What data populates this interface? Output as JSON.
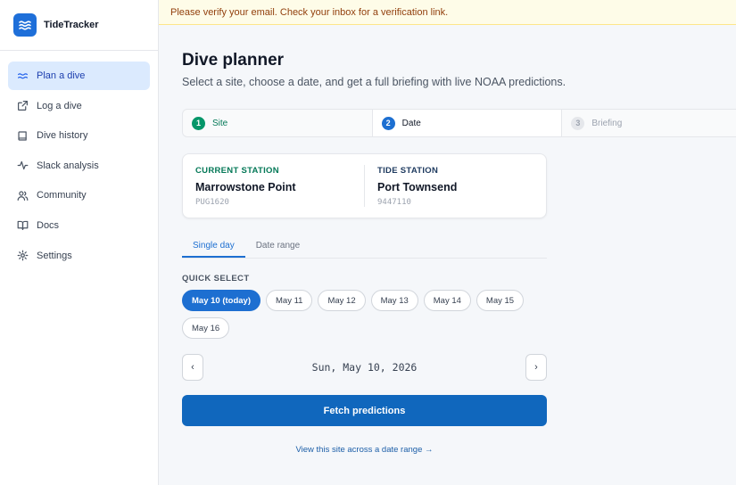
{
  "app": {
    "name": "TideTracker",
    "logo_icon": "waves-icon",
    "accent": "#1e6fd9"
  },
  "banner": {
    "text": "Please verify your email. Check your inbox for a verification link."
  },
  "sidebar": {
    "items": [
      {
        "label": "Plan a dive",
        "icon": "waves-icon",
        "active": true
      },
      {
        "label": "Log a dive",
        "icon": "external-link-icon"
      },
      {
        "label": "Dive history",
        "icon": "book-icon"
      },
      {
        "label": "Slack analysis",
        "icon": "activity-icon"
      },
      {
        "label": "Community",
        "icon": "users-icon"
      },
      {
        "label": "Docs",
        "icon": "book-open-icon"
      },
      {
        "label": "Settings",
        "icon": "gear-icon"
      }
    ]
  },
  "page": {
    "title": "Dive planner",
    "subtitle": "Select a site, choose a date, and get a full briefing with live NOAA predictions."
  },
  "stepper": {
    "steps": [
      {
        "num": "1",
        "label": "Site",
        "state": "done"
      },
      {
        "num": "2",
        "label": "Date",
        "state": "current"
      },
      {
        "num": "3",
        "label": "Briefing",
        "state": "upcoming"
      }
    ]
  },
  "stations": {
    "current": {
      "label": "CURRENT STATION",
      "name": "Marrowstone Point",
      "code": "PUG1620"
    },
    "tide": {
      "label": "TIDE STATION",
      "name": "Port Townsend",
      "code": "9447110"
    }
  },
  "tabs": {
    "single": "Single day",
    "range": "Date range"
  },
  "quick_select": {
    "label": "QUICK SELECT",
    "chips": [
      "May 10 (today)",
      "May 11",
      "May 12",
      "May 13",
      "May 14",
      "May 15",
      "May 16"
    ],
    "selected_index": 0
  },
  "date_nav": {
    "prev": "‹",
    "next": "›",
    "value": "Sun, May 10, 2026"
  },
  "actions": {
    "fetch": "Fetch predictions",
    "range_link": "View this site across a date range →"
  }
}
